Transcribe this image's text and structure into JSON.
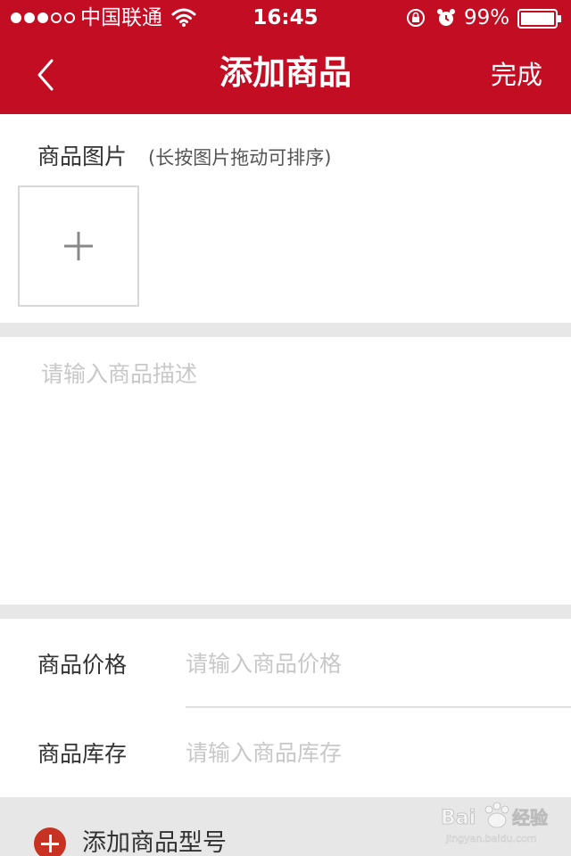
{
  "status_bar": {
    "carrier": "中国联通",
    "time": "16:45",
    "battery": "99%"
  },
  "nav": {
    "title": "添加商品",
    "done_label": "完成"
  },
  "photos": {
    "title": "商品图片",
    "hint": "(长按图片拖动可排序)"
  },
  "description": {
    "placeholder": "请输入商品描述"
  },
  "form": {
    "price_label": "商品价格",
    "price_placeholder": "请输入商品价格",
    "stock_label": "商品库存",
    "stock_placeholder": "请输入商品库存"
  },
  "add_model": {
    "label": "添加商品型号"
  },
  "colors": {
    "brand_red": "#c30d23",
    "section_gap": "#e7e7e7"
  }
}
